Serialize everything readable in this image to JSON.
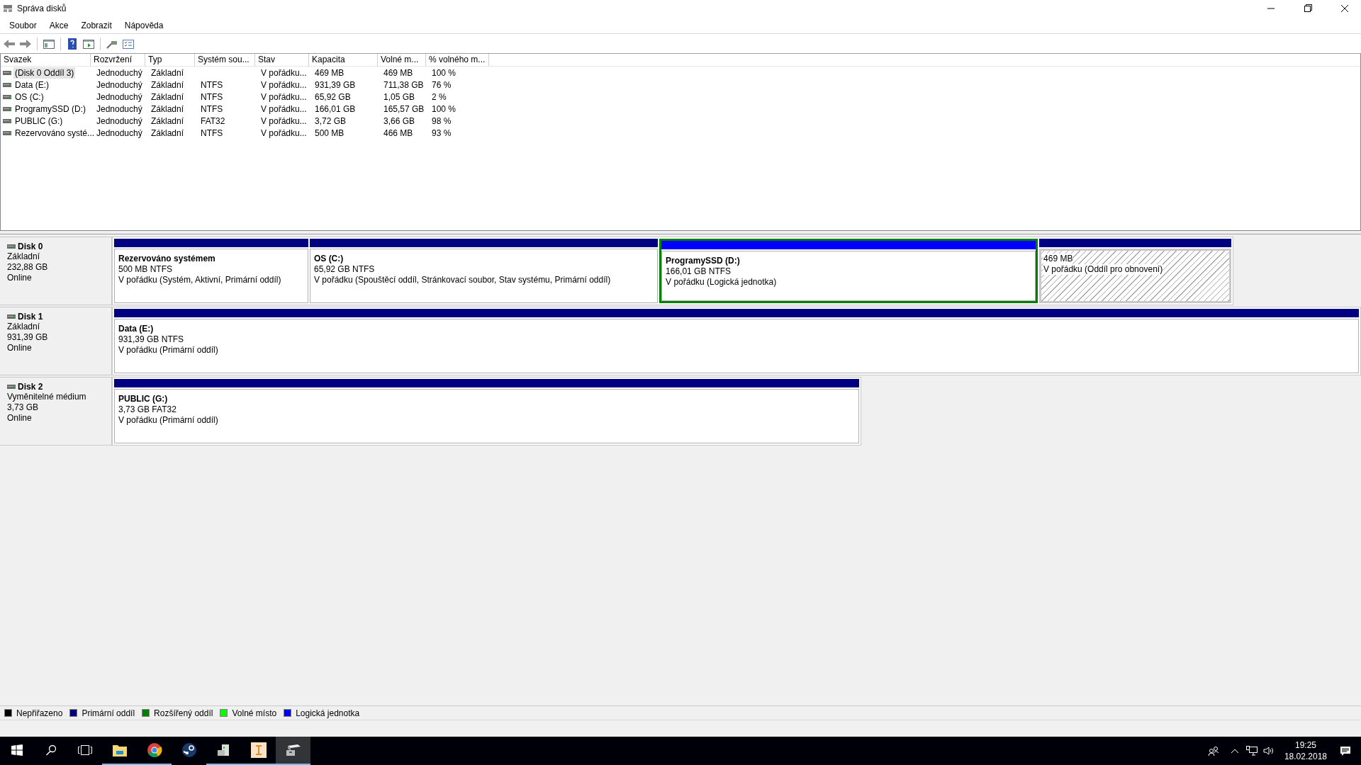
{
  "window": {
    "title": "Správa disků"
  },
  "menu": [
    "Soubor",
    "Akce",
    "Zobrazit",
    "Nápověda"
  ],
  "table": {
    "columns": [
      "Svazek",
      "Rozvržení",
      "Typ",
      "Systém sou...",
      "Stav",
      "Kapacita",
      "Volné m...",
      "% volného m..."
    ],
    "rows": [
      {
        "selected": true,
        "cells": [
          "(Disk 0 Oddíl 3)",
          "Jednoduchý",
          "Základní",
          "",
          "V pořádku...",
          "469 MB",
          "469 MB",
          "100 %"
        ]
      },
      {
        "selected": false,
        "cells": [
          "Data (E:)",
          "Jednoduchý",
          "Základní",
          "NTFS",
          "V pořádku...",
          "931,39 GB",
          "711,38 GB",
          "76 %"
        ]
      },
      {
        "selected": false,
        "cells": [
          "OS (C:)",
          "Jednoduchý",
          "Základní",
          "NTFS",
          "V pořádku...",
          "65,92 GB",
          "1,05 GB",
          "2 %"
        ]
      },
      {
        "selected": false,
        "cells": [
          "ProgramySSD (D:)",
          "Jednoduchý",
          "Základní",
          "NTFS",
          "V pořádku...",
          "166,01 GB",
          "165,57 GB",
          "100 %"
        ]
      },
      {
        "selected": false,
        "cells": [
          "PUBLIC (G:)",
          "Jednoduchý",
          "Základní",
          "FAT32",
          "V pořádku...",
          "3,72 GB",
          "3,66 GB",
          "98 %"
        ]
      },
      {
        "selected": false,
        "cells": [
          "Rezervováno systé...",
          "Jednoduchý",
          "Základní",
          "NTFS",
          "V pořádku...",
          "500 MB",
          "466 MB",
          "93 %"
        ]
      }
    ]
  },
  "disks": [
    {
      "name": "Disk 0",
      "type": "Základní",
      "size": "232,88 GB",
      "status": "Online",
      "partitions": [
        {
          "kind": "primary",
          "selected": false,
          "name": "Rezervováno systémem",
          "size": "500 MB NTFS",
          "status": "V pořádku (Systém, Aktivní, Primární oddíl)"
        },
        {
          "kind": "primary",
          "selected": false,
          "name": "OS  (C:)",
          "size": "65,92 GB NTFS",
          "status": "V pořádku (Spouštěcí oddíl, Stránkovací soubor, Stav systému, Primární oddíl)"
        },
        {
          "kind": "logical",
          "selected": false,
          "name": "ProgramySSD  (D:)",
          "size": "166,01 GB NTFS",
          "status": "V pořádku (Logická jednotka)"
        },
        {
          "kind": "primary",
          "selected": true,
          "size": "469 MB",
          "status": "V pořádku (Oddíl pro obnovení)"
        }
      ]
    },
    {
      "name": "Disk 1",
      "type": "Základní",
      "size": "931,39 GB",
      "status": "Online",
      "partitions": [
        {
          "kind": "primary",
          "selected": false,
          "name": "Data  (E:)",
          "size": "931,39 GB NTFS",
          "status": "V pořádku (Primární oddíl)"
        }
      ]
    },
    {
      "name": "Disk 2",
      "type": "Vyměnitelné médium",
      "size": "3,73 GB",
      "status": "Online",
      "partitions": [
        {
          "kind": "primary",
          "selected": false,
          "name": "PUBLIC  (G:)",
          "size": "3,73 GB FAT32",
          "status": "V pořádku (Primární oddíl)"
        }
      ]
    }
  ],
  "legend": [
    {
      "label": "Nepřiřazeno",
      "color": "#000000"
    },
    {
      "label": "Primární oddíl",
      "color": "#000080"
    },
    {
      "label": "Rozšířený oddíl",
      "color": "#008000"
    },
    {
      "label": "Volné místo",
      "color": "#00ff00"
    },
    {
      "label": "Logická jednotka",
      "color": "#0000ff"
    }
  ],
  "taskbar": {
    "apps": [
      {
        "kind": "explorer",
        "running": true,
        "selected": false
      },
      {
        "kind": "chrome",
        "running": true,
        "selected": false
      },
      {
        "kind": "steam",
        "running": false,
        "selected": false
      },
      {
        "kind": "drive",
        "running": true,
        "selected": false
      },
      {
        "kind": "designer",
        "running": true,
        "selected": false
      },
      {
        "kind": "diskmgmt",
        "running": false,
        "selected": true
      }
    ],
    "time": "19:25",
    "date": "18.02.2018"
  }
}
